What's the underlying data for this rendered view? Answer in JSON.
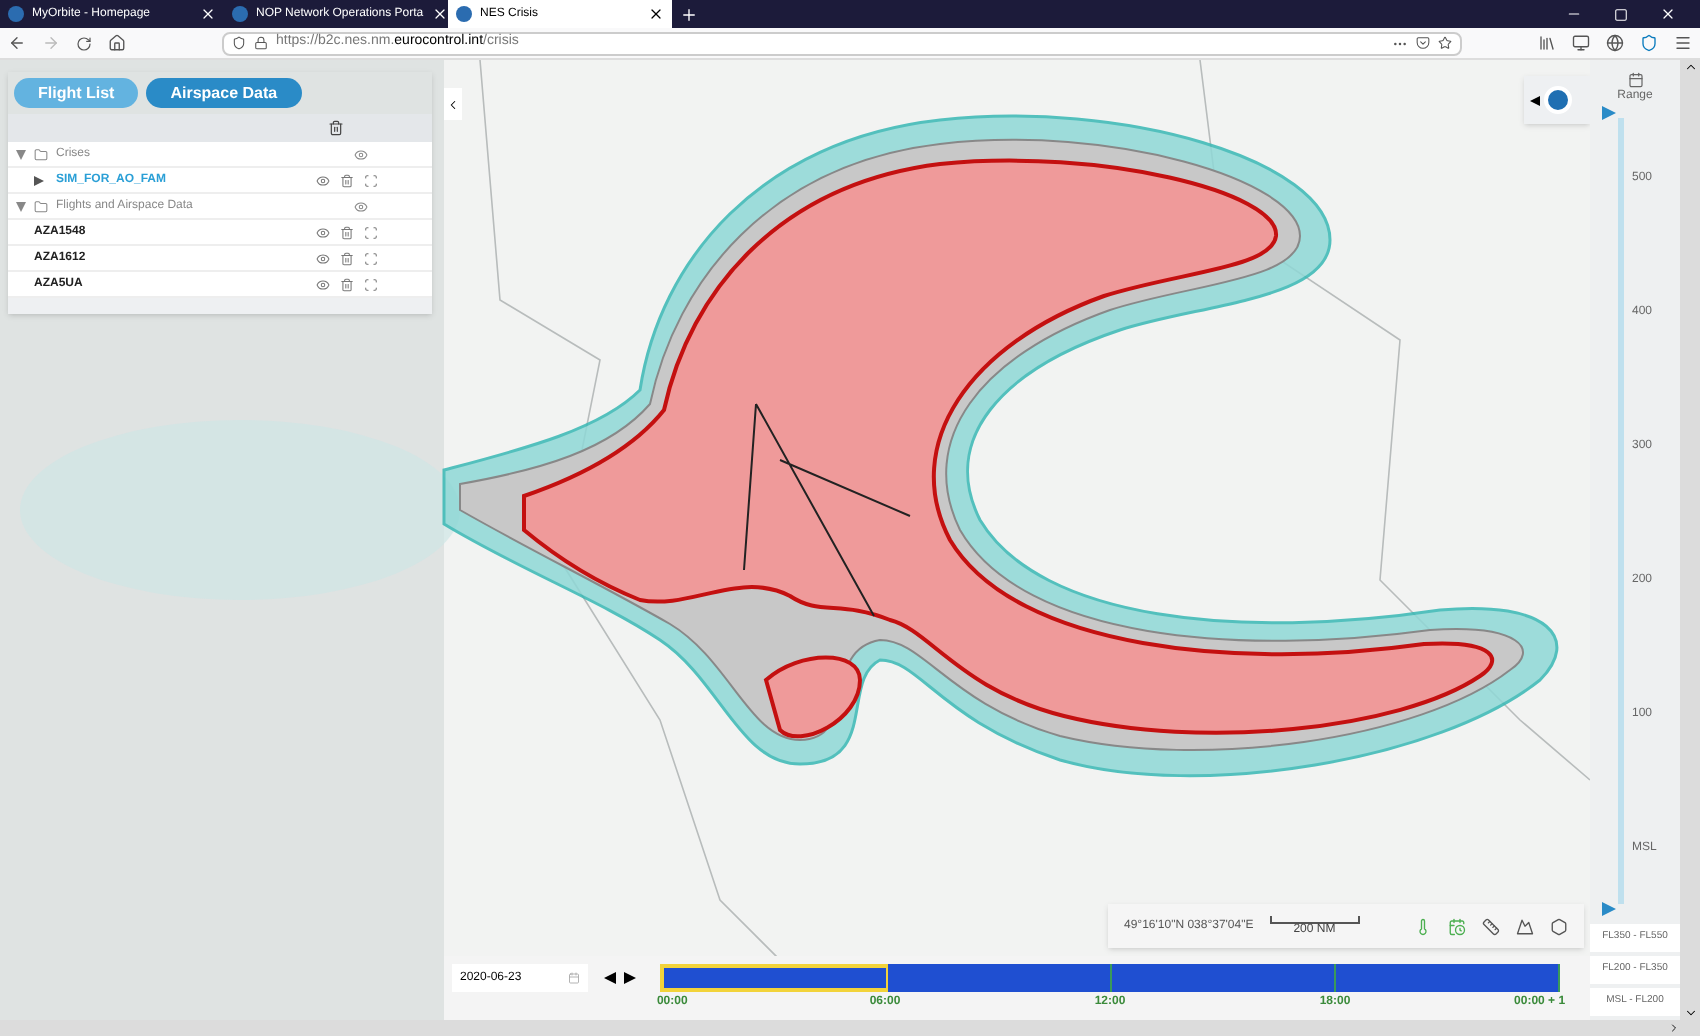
{
  "browser": {
    "tabs": [
      {
        "title": "MyOrbite - Homepage",
        "selected": false
      },
      {
        "title": "NOP Network Operations Porta",
        "selected": false
      },
      {
        "title": "NES Crisis",
        "selected": true
      }
    ],
    "url_prefix": "https://b2c.nes.nm.",
    "url_domain": "eurocontrol.int",
    "url_path": "/crisis"
  },
  "panel": {
    "buttons": [
      {
        "label": "Flight List",
        "selected": false
      },
      {
        "label": "Airspace Data",
        "selected": true
      }
    ],
    "groups": [
      {
        "label": "Crises",
        "expanded": true,
        "items": [
          {
            "kind": "scenario",
            "label": "SIM_FOR_AO_FAM"
          }
        ]
      },
      {
        "label": "Flights and Airspace Data",
        "expanded": true,
        "items": [
          {
            "kind": "flight",
            "label": "AZA1548"
          },
          {
            "kind": "flight",
            "label": "AZA1612"
          },
          {
            "kind": "flight",
            "label": "AZA5UA"
          }
        ]
      }
    ]
  },
  "altitude": {
    "range_label": "Range",
    "ticks": [
      "500",
      "400",
      "300",
      "200",
      "100",
      "MSL"
    ],
    "fl_buttons": [
      "FL350 - FL550",
      "FL200 - FL350",
      "MSL - FL200"
    ]
  },
  "map_toolbar": {
    "coordinates": "49°16'10\"N 038°37'04\"E",
    "scale": "200 NM"
  },
  "timeline": {
    "date": "2020-06-23",
    "segments": [
      {
        "selected": true
      },
      {
        "selected": false
      },
      {
        "selected": false
      },
      {
        "selected": false
      }
    ],
    "ticks": [
      "00:00",
      "06:00",
      "12:00",
      "18:00",
      "00:00 + 1"
    ]
  }
}
